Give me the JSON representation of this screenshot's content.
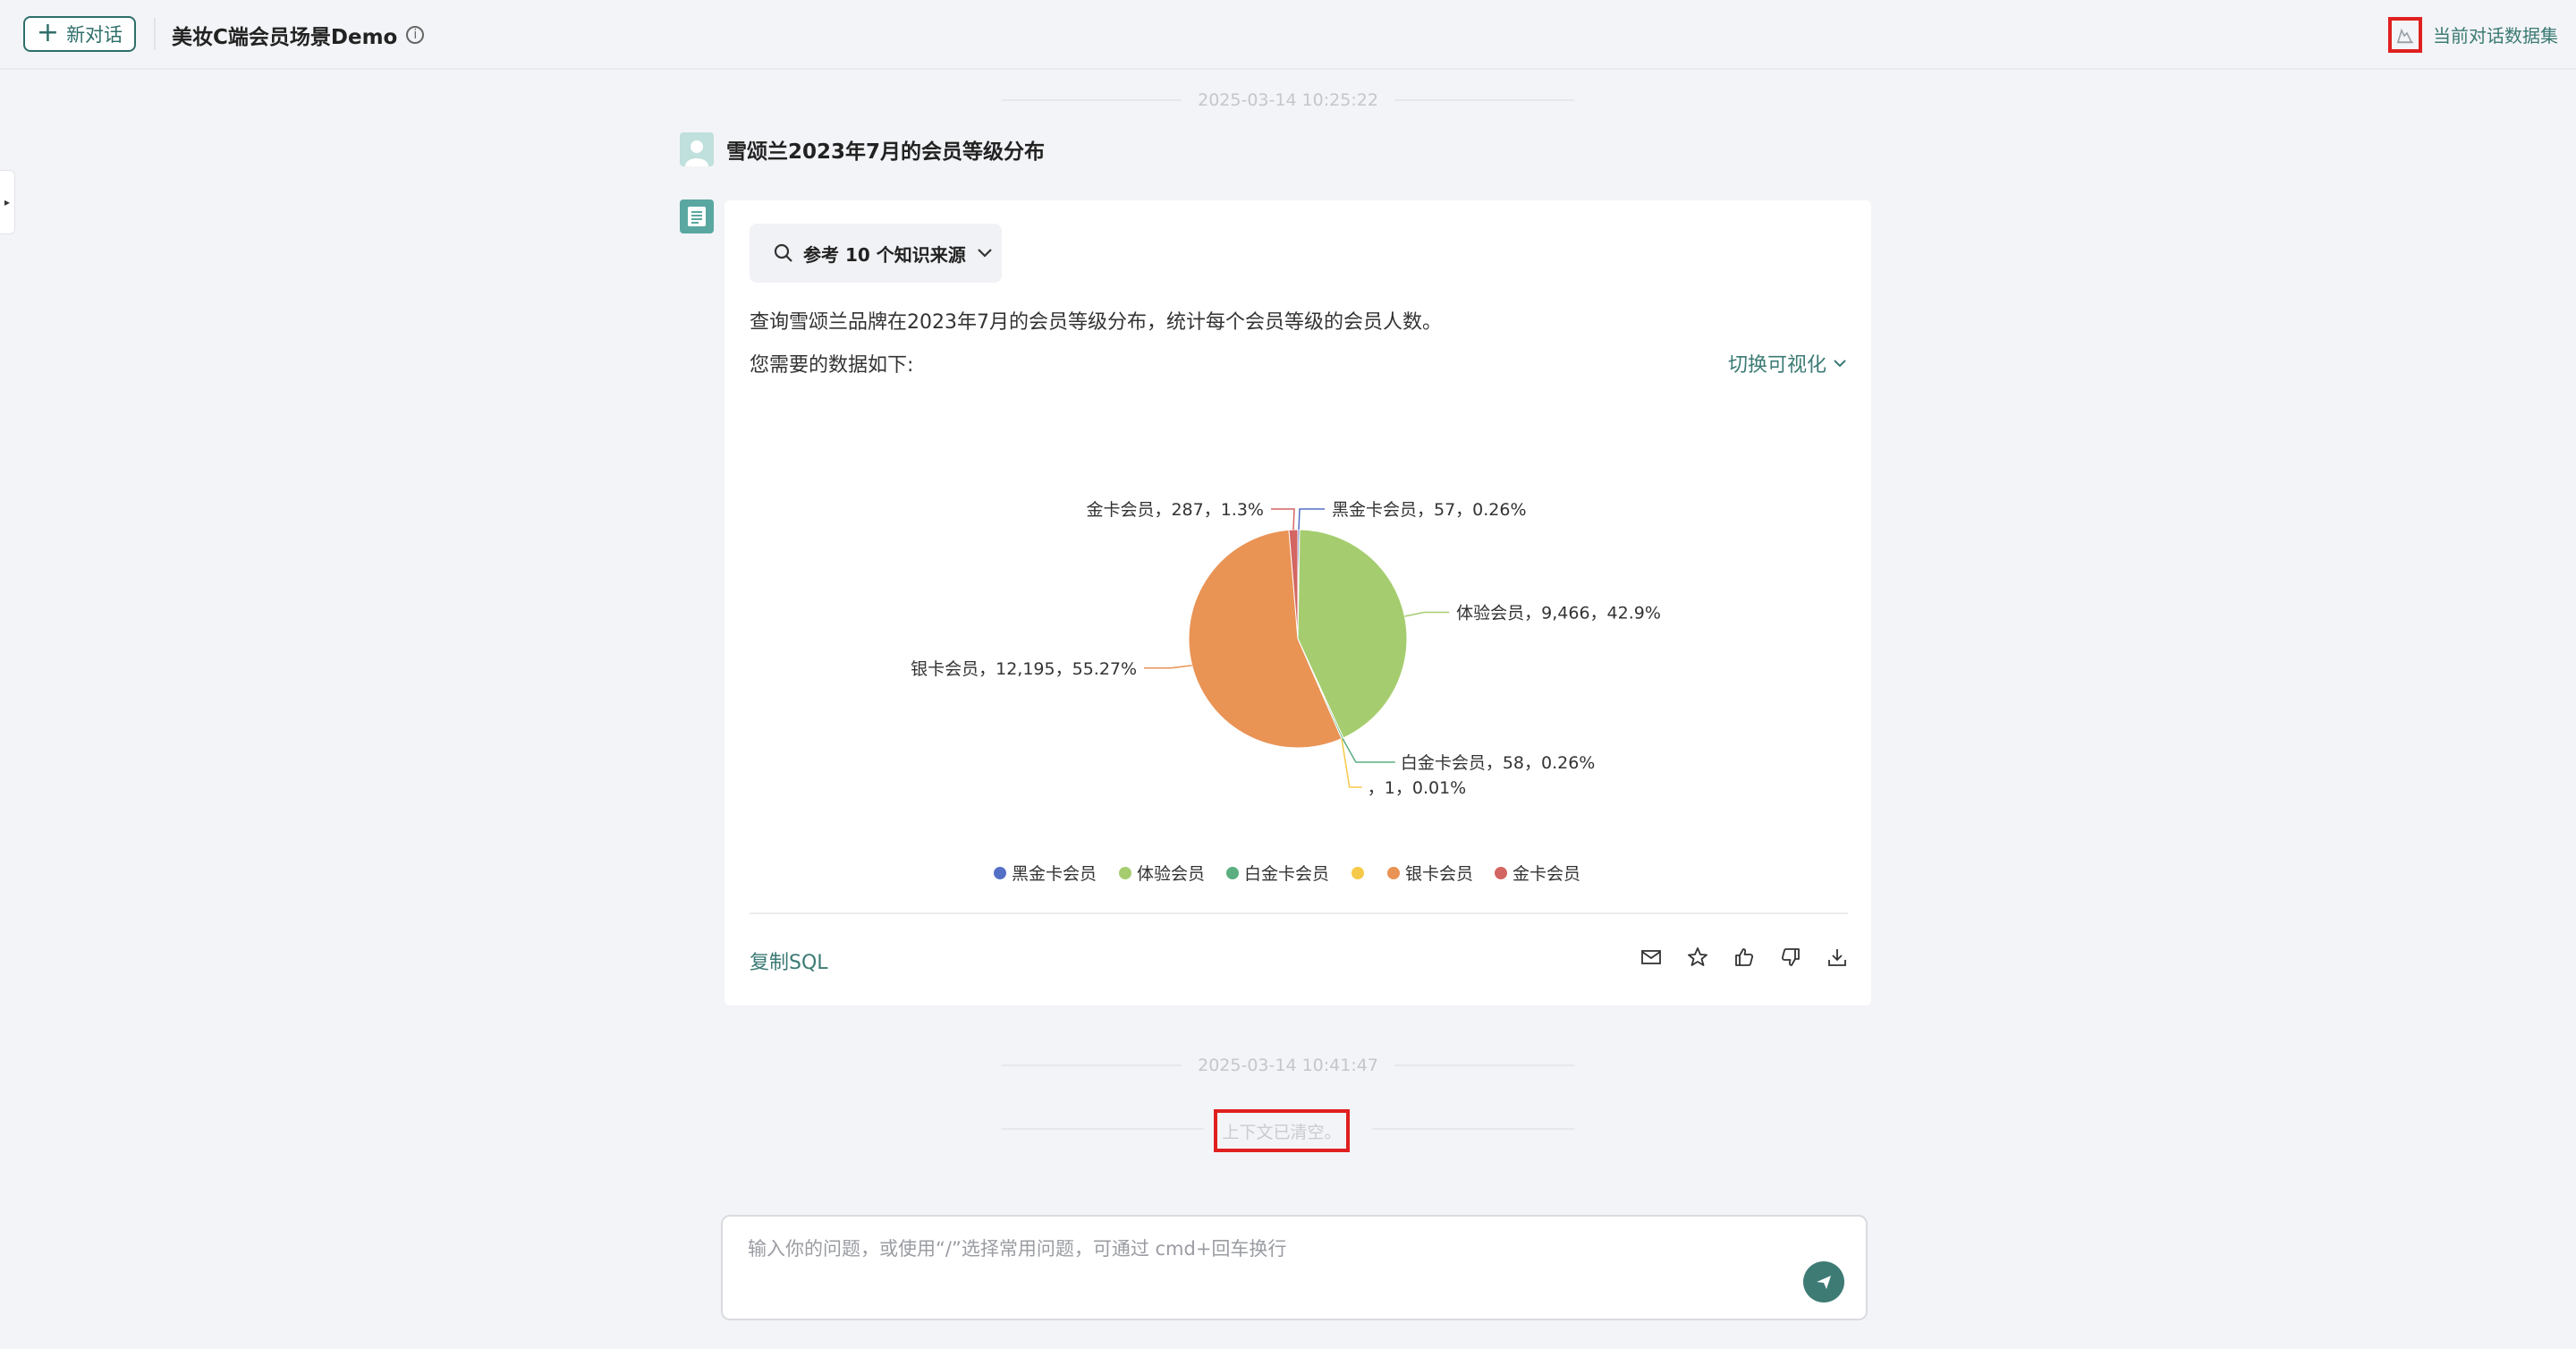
{
  "header": {
    "new_chat_label": "新对话",
    "app_title": "美妆C端会员场景Demo",
    "dataset_link": "当前对话数据集"
  },
  "conversation": {
    "timestamp1": "2025-03-14 10:25:22",
    "user_question": "雪颂兰2023年7月的会员等级分布",
    "references_label": "参考 10 个知识来源",
    "description": "查询雪颂兰品牌在2023年7月的会员等级分布，统计每个会员等级的会员人数。",
    "data_label": "您需要的数据如下:",
    "switch_viz_label": "切换可视化",
    "copy_sql_label": "复制SQL",
    "timestamp2": "2025-03-14 10:41:47",
    "context_cleared": "上下文已清空。"
  },
  "input": {
    "placeholder": "输入你的问题，或使用“/”选择常用问题，可通过 cmd+回车换行"
  },
  "colors": {
    "accent": "#3b7a74",
    "highlight_box": "#e02020"
  },
  "chart_data": {
    "type": "pie",
    "series": [
      {
        "name": "黑金卡会员",
        "value": 57,
        "percent": "0.26%",
        "color": "#5470c6",
        "label": "黑金卡会员，57，0.26%"
      },
      {
        "name": "体验会员",
        "value": 9466,
        "percent": "42.9%",
        "color": "#a5cd6f",
        "label": "体验会员，9,466，42.9%"
      },
      {
        "name": "白金卡会员",
        "value": 58,
        "percent": "0.26%",
        "color": "#5bae80",
        "label": "白金卡会员，58，0.26%"
      },
      {
        "name": "",
        "value": 1,
        "percent": "0.01%",
        "color": "#f7c948",
        "label": "，1，0.01%"
      },
      {
        "name": "银卡会员",
        "value": 12195,
        "percent": "55.27%",
        "color": "#e99355",
        "label": "银卡会员，12,195，55.27%"
      },
      {
        "name": "金卡会员",
        "value": 287,
        "percent": "1.3%",
        "color": "#d36662",
        "label": "金卡会员，287，1.3%"
      }
    ],
    "legend": [
      "黑金卡会员",
      "体验会员",
      "白金卡会员",
      "",
      "银卡会员",
      "金卡会员"
    ],
    "legend_position": "bottom"
  }
}
